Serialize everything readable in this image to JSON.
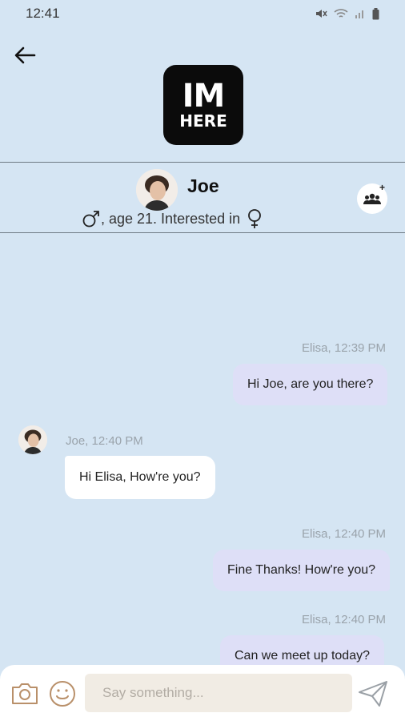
{
  "status_bar": {
    "time": "12:41"
  },
  "header": {
    "logo_line1": "IM",
    "logo_line2": "HERE",
    "back_icon": "arrow-left-icon"
  },
  "profile": {
    "name": "Joe",
    "details_text": ", age 21. Interested in",
    "gender_icon": "male-symbol-icon",
    "interest_icon": "female-symbol-icon",
    "group_icon": "group-add-icon"
  },
  "messages": [
    {
      "direction": "out",
      "sender_time": "Elisa,  12:39 PM",
      "text": "Hi Joe, are you there?"
    },
    {
      "direction": "in",
      "sender_time": "Joe,  12:40 PM",
      "text": "Hi Elisa, How're you?"
    },
    {
      "direction": "out",
      "sender_time": "Elisa,  12:40 PM",
      "text": "Fine Thanks! How're you?"
    },
    {
      "direction": "out",
      "sender_time": "Elisa,  12:40 PM",
      "text": "Can we meet up today?"
    }
  ],
  "composer": {
    "placeholder": "Say something...",
    "camera_icon": "camera-icon",
    "emoji_icon": "emoji-icon",
    "send_icon": "send-icon"
  },
  "colors": {
    "background": "#d5e5f3",
    "outgoing_bubble": "#dedff7",
    "incoming_bubble": "#ffffff",
    "input_bg": "#f1ece4"
  }
}
